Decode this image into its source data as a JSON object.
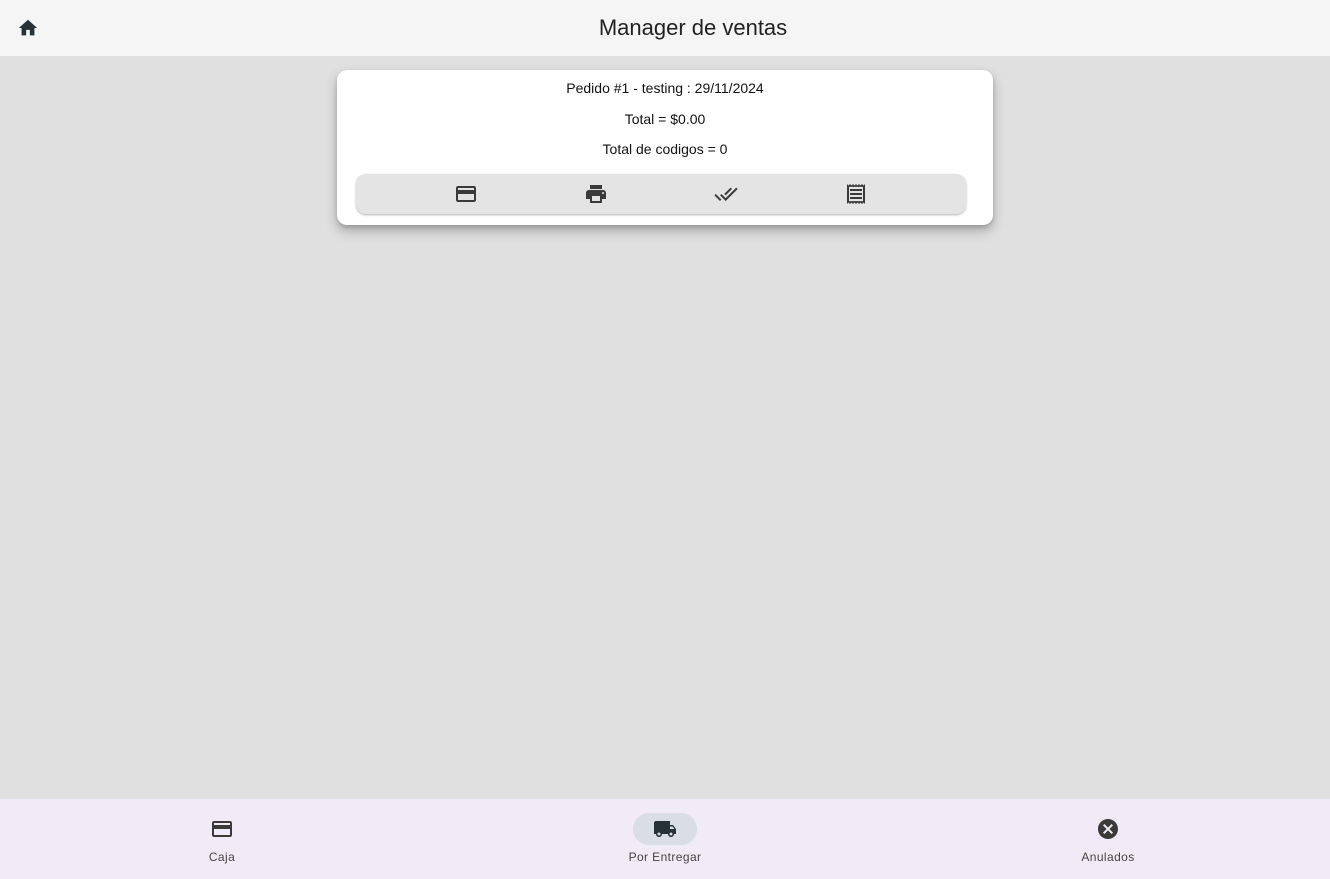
{
  "appbar": {
    "title": "Manager de ventas",
    "home_icon": "home-icon"
  },
  "order": {
    "title": "Pedido #1 - testing : 29/11/2024",
    "total": "Total = $0.00",
    "codes_total": "Total de codigos = 0",
    "actions": [
      {
        "icon": "credit-card-icon"
      },
      {
        "icon": "print-icon"
      },
      {
        "icon": "done-all-icon"
      },
      {
        "icon": "receipt-icon"
      }
    ]
  },
  "bottom_nav": {
    "items": [
      {
        "label": "Caja",
        "icon": "credit-card-icon",
        "active": false
      },
      {
        "label": "Por Entregar",
        "icon": "truck-icon",
        "active": true
      },
      {
        "label": "Anulados",
        "icon": "cancel-icon",
        "active": false
      }
    ]
  },
  "colors": {
    "appbar_bg": "#f5f5f5",
    "body_bg": "#e0e0e0",
    "nav_bg": "#f1ebf7",
    "nav_active_indicator": "#d8dde6",
    "icon": "#3a3a3a"
  }
}
